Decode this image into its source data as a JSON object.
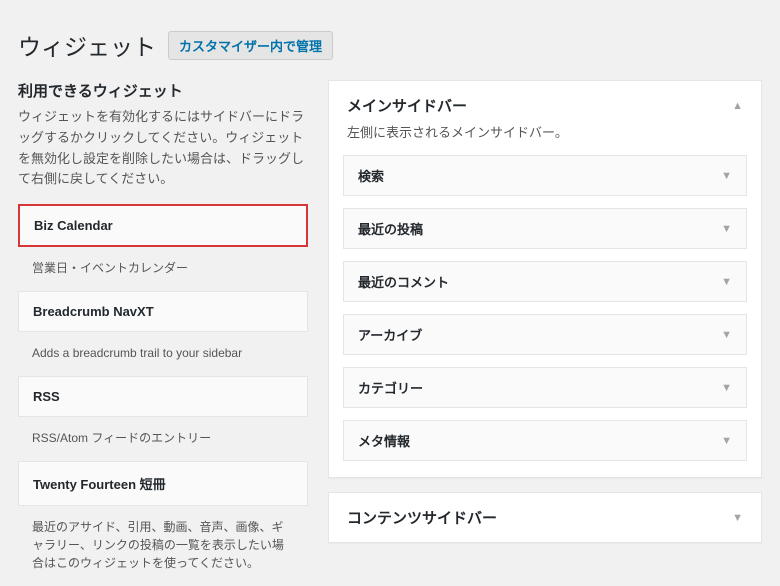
{
  "page_title": "ウィジェット",
  "customizer_button": "カスタマイザー内で管理",
  "available": {
    "heading": "利用できるウィジェット",
    "description": "ウィジェットを有効化するにはサイドバーにドラッグするかクリックしてください。ウィジェットを無効化し設定を削除したい場合は、ドラッグして右側に戻してください。"
  },
  "available_widgets": [
    {
      "title": "Biz Calendar",
      "desc": "営業日・イベントカレンダー",
      "highlighted": true
    },
    {
      "title": "Breadcrumb NavXT",
      "desc": "Adds a breadcrumb trail to your sidebar",
      "highlighted": false
    },
    {
      "title": "RSS",
      "desc": "RSS/Atom フィードのエントリー",
      "highlighted": false
    },
    {
      "title": "Twenty Fourteen 短冊",
      "desc": "最近のアサイド、引用、動画、音声、画像、ギャラリー、リンクの投稿の一覧を表示したい場合はこのウィジェットを使ってください。",
      "highlighted": false
    }
  ],
  "sidebars": [
    {
      "title": "メインサイドバー",
      "description": "左側に表示されるメインサイドバー。",
      "expanded": true,
      "widgets": [
        {
          "name": "検索"
        },
        {
          "name": "最近の投稿"
        },
        {
          "name": "最近のコメント"
        },
        {
          "name": "アーカイブ"
        },
        {
          "name": "カテゴリー"
        },
        {
          "name": "メタ情報"
        }
      ]
    },
    {
      "title": "コンテンツサイドバー",
      "description": "",
      "expanded": false,
      "widgets": []
    }
  ]
}
